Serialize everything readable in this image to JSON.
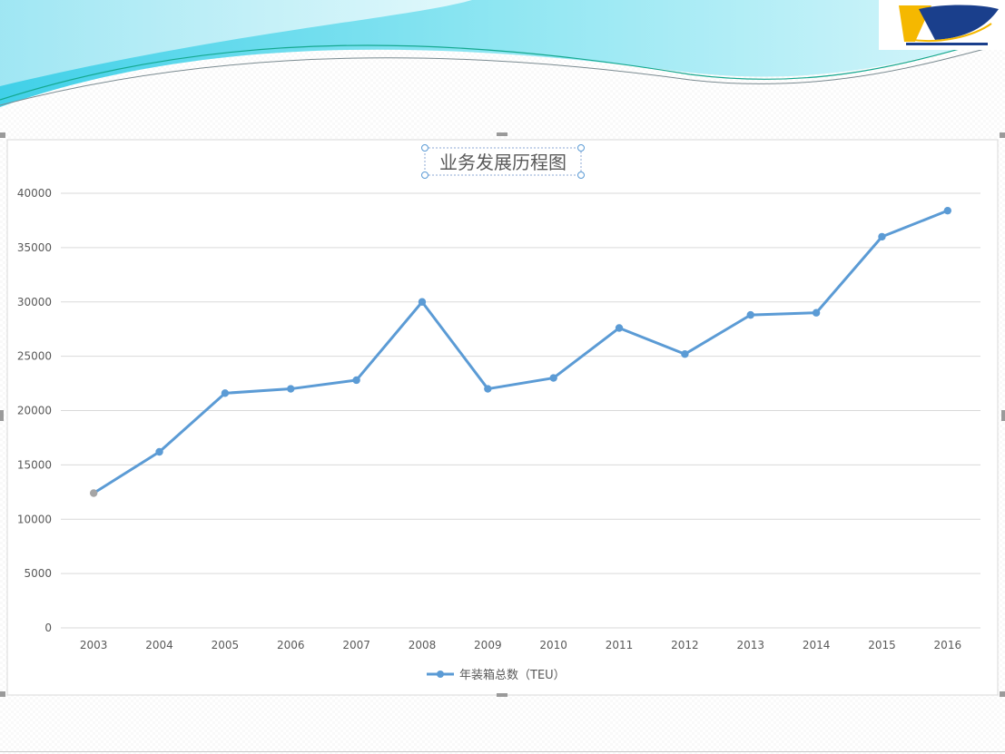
{
  "logo": {
    "mark": "logo-mark"
  },
  "chart_data": {
    "type": "line",
    "title": "业务发展历程图",
    "categories": [
      "2003",
      "2004",
      "2005",
      "2006",
      "2007",
      "2008",
      "2009",
      "2010",
      "2011",
      "2012",
      "2013",
      "2014",
      "2015",
      "2016"
    ],
    "series": [
      {
        "name": "年装箱总数（TEU）",
        "color": "#5b9bd5",
        "values": [
          12400,
          16200,
          21600,
          22000,
          22800,
          30000,
          22000,
          23000,
          27600,
          25200,
          28800,
          29000,
          36000,
          38400
        ]
      }
    ],
    "first_point_color": "#a5a5a5",
    "ylim": [
      0,
      40000
    ],
    "yticks": [
      0,
      5000,
      10000,
      15000,
      20000,
      25000,
      30000,
      35000,
      40000
    ],
    "grid": true,
    "legend": "bottom"
  }
}
